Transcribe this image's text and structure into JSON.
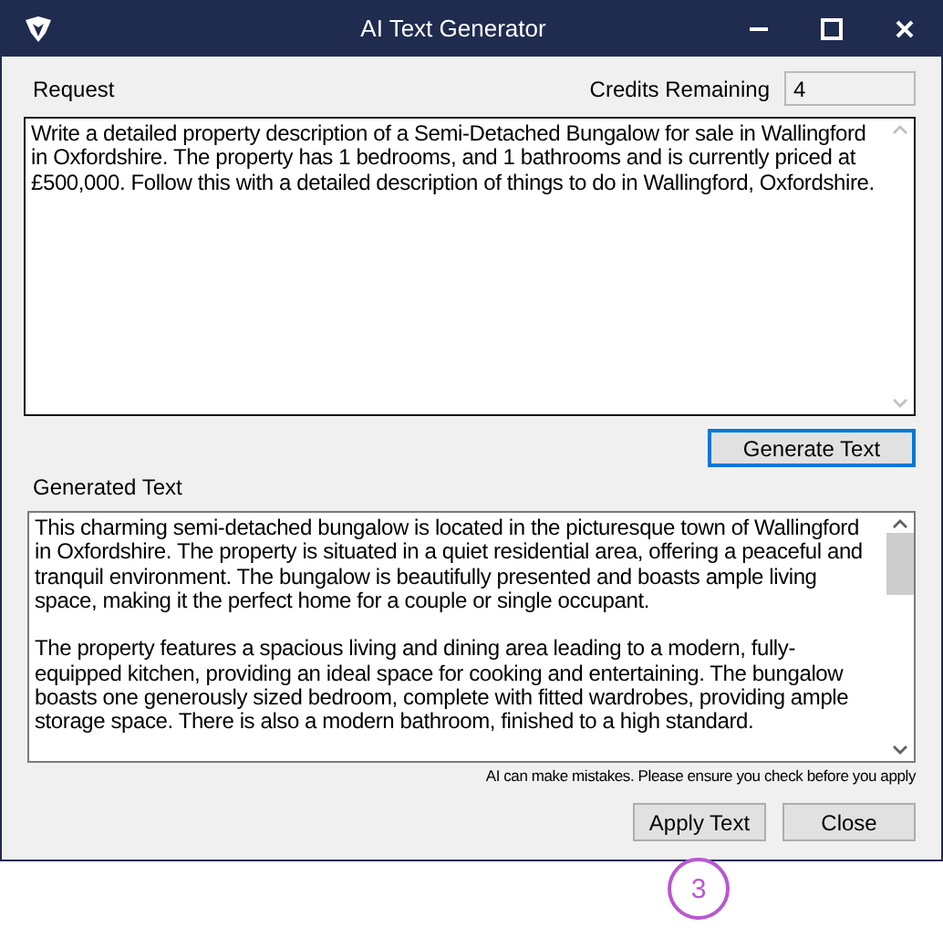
{
  "window": {
    "title": "AI Text Generator"
  },
  "request": {
    "label": "Request",
    "text": "Write a detailed property description of a Semi-Detached Bungalow for sale in Wallingford in Oxfordshire. The property has 1 bedrooms, and 1 bathrooms and is currently priced at £500,000. Follow this with a detailed description of things to do in Wallingford, Oxfordshire."
  },
  "credits": {
    "label": "Credits Remaining",
    "value": "4"
  },
  "generate_button": {
    "label": "Generate Text",
    "focused": true
  },
  "generated": {
    "label": "Generated Text",
    "paragraphs": [
      "This charming semi-detached bungalow is located in the picturesque town of Wallingford in Oxfordshire. The property is situated in a quiet residential area, offering a peaceful and tranquil environment. The bungalow is beautifully presented and boasts ample living space, making it the perfect home for a couple or single occupant.",
      "The property features a spacious living and dining area leading to a modern, fully-equipped kitchen, providing an ideal space for cooking and entertaining. The bungalow boasts one generously sized bedroom, complete with fitted wardrobes, providing ample storage space. There is also a modern bathroom, finished to a high standard."
    ]
  },
  "disclaimer": "AI can make mistakes. Please ensure you check before you apply",
  "buttons": [
    "Apply Text",
    "Close"
  ],
  "annotation": "3"
}
